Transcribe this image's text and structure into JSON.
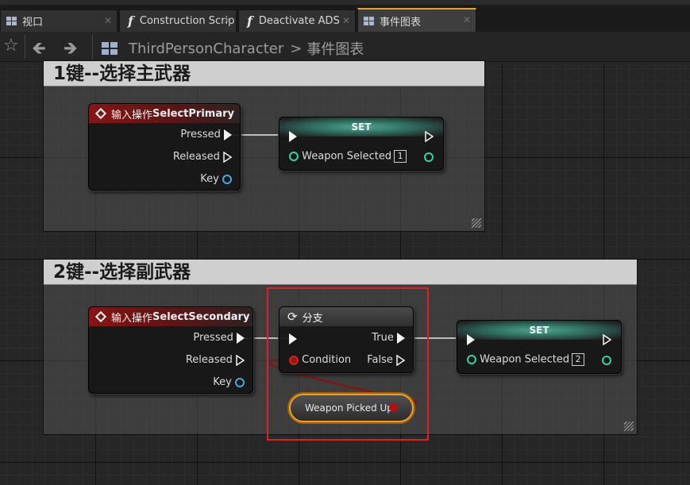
{
  "tabs": [
    {
      "label": "视口",
      "icon": "viewport-icon",
      "active": false
    },
    {
      "label": "Construction Scrip",
      "icon": "function-icon",
      "active": false
    },
    {
      "label": "Deactivate ADS",
      "icon": "function-icon",
      "active": false
    },
    {
      "label": "事件图表",
      "icon": "event-graph-icon",
      "active": true
    }
  ],
  "breadcrumb": {
    "root": "ThirdPersonCharacter",
    "separator": ">",
    "current": "事件图表"
  },
  "comments": [
    {
      "title": "1键--选择主武器"
    },
    {
      "title": "2键--选择副武器"
    }
  ],
  "nodes": {
    "select_primary": {
      "title_prefix": "输入操作",
      "title_name": "SelectPrimary",
      "pins": [
        "Pressed",
        "Released",
        "Key"
      ]
    },
    "set1": {
      "title": "SET",
      "var_label": "Weapon Selected",
      "var_value": "1"
    },
    "select_secondary": {
      "title_prefix": "输入操作",
      "title_name": "SelectSecondary",
      "pins": [
        "Pressed",
        "Released",
        "Key"
      ]
    },
    "branch": {
      "title": "分支",
      "condition": "Condition",
      "true_label": "True",
      "false_label": "False"
    },
    "set2": {
      "title": "SET",
      "var_label": "Weapon Selected",
      "var_value": "2"
    },
    "weapon_picked_up": {
      "label": "Weapon Picked Up"
    }
  },
  "colors": {
    "exec": "#f4f4f4",
    "bool_pin": "#b31010",
    "int_pin": "#2fd6a2",
    "key_pin": "#4aa8e8",
    "highlight": "#e02020",
    "accent": "#e7a628"
  }
}
